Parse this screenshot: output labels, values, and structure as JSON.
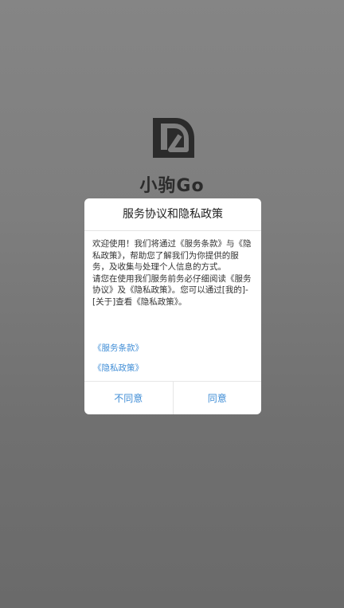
{
  "app": {
    "name": "小驹Go",
    "logo_icon": "leaf-logo-icon"
  },
  "dialog": {
    "title": "服务协议和隐私政策",
    "body_paragraph_1": "欢迎使用！我们将通过《服务条款》与《隐私政策》，帮助您了解我们为你提供的服务，及收集与处理个人信息的方式。",
    "body_paragraph_2": "请您在使用我们服务前务必仔细阅读《服务协议》及《隐私政策》。您可以通过[我的]-[关于]查看《隐私政策》。",
    "link_terms": "《服务条款》",
    "link_privacy": "《隐私政策》",
    "disagree_label": "不同意",
    "agree_label": "同意"
  },
  "colors": {
    "accent": "#3f8dd6",
    "overlay": "#7a7a7a",
    "logo": "#2b2b2b"
  }
}
